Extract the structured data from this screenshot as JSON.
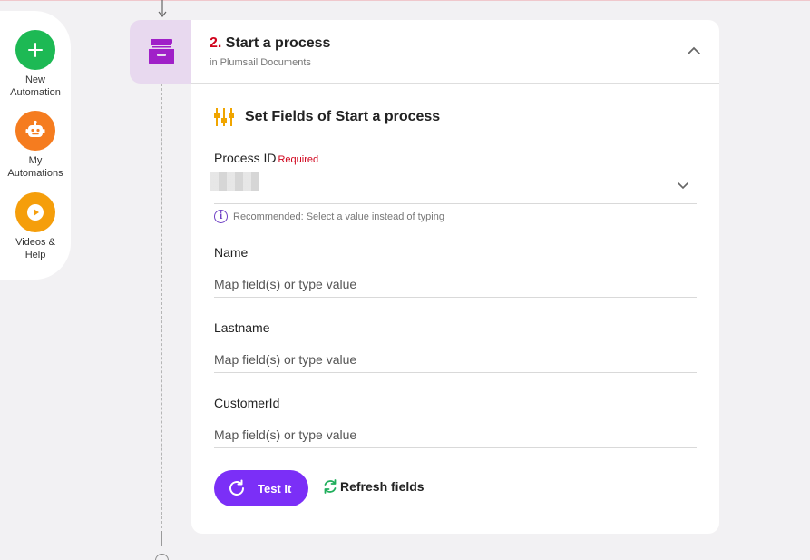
{
  "sidebar": {
    "items": [
      {
        "label_line1": "New",
        "label_line2": "Automation",
        "icon": "plus-icon",
        "color": "#1db954"
      },
      {
        "label_line1": "My",
        "label_line2": "Automations",
        "icon": "robot-icon",
        "color": "#f57c1f"
      },
      {
        "label_line1": "Videos &",
        "label_line2": "Help",
        "icon": "play-icon",
        "color": "#f59e0b"
      }
    ]
  },
  "step": {
    "number": "2.",
    "title": "Start a process",
    "subtitle": "in Plumsail Documents",
    "app_icon": "archive-box-icon",
    "app_color": "#a020c8"
  },
  "section": {
    "title": "Set Fields of Start a process",
    "icon": "sliders-icon"
  },
  "fields": {
    "process_id": {
      "label": "Process ID",
      "required": "Required",
      "hint": "Recommended: Select a value instead of typing"
    },
    "name": {
      "label": "Name",
      "placeholder": "Map field(s) or type value"
    },
    "lastname": {
      "label": "Lastname",
      "placeholder": "Map field(s) or type value"
    },
    "customer_id": {
      "label": "CustomerId",
      "placeholder": "Map field(s) or type value"
    }
  },
  "actions": {
    "test_label": "Test It",
    "refresh_label": "Refresh fields"
  },
  "colors": {
    "accent": "#7b2ff7",
    "required": "#d0021b",
    "refresh_icon": "#1fae5b",
    "sliders_icon": "#f0a500"
  }
}
